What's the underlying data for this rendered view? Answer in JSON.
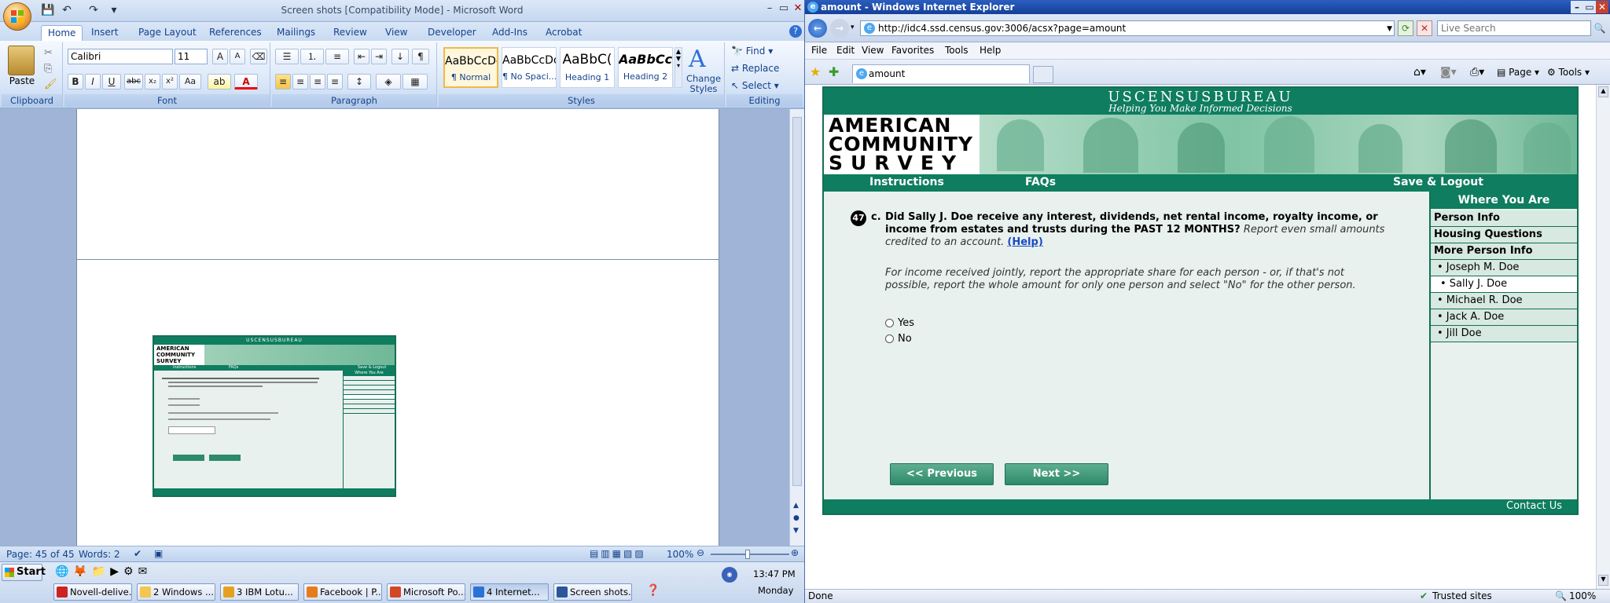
{
  "word": {
    "title": "Screen shots [Compatibility Mode] - Microsoft Word",
    "tabs": [
      "Home",
      "Insert",
      "Page Layout",
      "References",
      "Mailings",
      "Review",
      "View",
      "Developer",
      "Add-Ins",
      "Acrobat"
    ],
    "clipboard": {
      "paste": "Paste",
      "label": "Clipboard"
    },
    "font": {
      "name": "Calibri",
      "size": "11",
      "label": "Font"
    },
    "paragraph": {
      "label": "Paragraph"
    },
    "styles": {
      "label": "Styles",
      "items": [
        {
          "sample": "AaBbCcDc",
          "name": "¶ Normal"
        },
        {
          "sample": "AaBbCcDc",
          "name": "¶ No Spaci..."
        },
        {
          "sample": "AaBbC(",
          "name": "Heading 1"
        },
        {
          "sample": "AaBbCc",
          "name": "Heading 2"
        }
      ],
      "change": "Change Styles"
    },
    "editing": {
      "find": "Find",
      "replace": "Replace",
      "select": "Select",
      "label": "Editing"
    },
    "status": {
      "page": "Page: 45 of 45",
      "words": "Words: 2",
      "zoom": "100%"
    },
    "thumb": {
      "brand": "USCENSUSBUREAU",
      "lines": [
        "AMERICAN",
        "COMMUNITY",
        "SURVEY"
      ],
      "nav": [
        "Instructions",
        "FAQs",
        "Save & Logout"
      ],
      "side_title": "Where You Are"
    }
  },
  "taskbar": {
    "start": "Start",
    "time": "13:47 PM",
    "day": "Monday",
    "buttons": [
      "Novell-delive...",
      "2 Windows ...",
      "3 IBM Lotu...",
      "Facebook | P...",
      "Microsoft Po...",
      "4 Internet...",
      "Screen shots..."
    ]
  },
  "ie": {
    "title": "amount - Windows Internet Explorer",
    "url": "http://idc4.ssd.census.gov:3006/acsx?page=amount",
    "search_placeholder": "Live Search",
    "menu": [
      "File",
      "Edit",
      "View",
      "Favorites",
      "Tools",
      "Help"
    ],
    "tab": "amount",
    "toolbar": {
      "page": "Page",
      "tools": "Tools"
    },
    "status": {
      "left": "Done",
      "zone": "Trusted sites",
      "zoom": "100%"
    }
  },
  "acs": {
    "brand": "USCENSUSBUREAU",
    "tagline": "Helping You Make Informed Decisions",
    "logo": [
      "AMERICAN",
      "COMMUNITY",
      "SURVEY"
    ],
    "nav": {
      "instructions": "Instructions",
      "faqs": "FAQs",
      "logout": "Save & Logout"
    },
    "question": {
      "number": "47",
      "letter": "c.",
      "text": "Did Sally J. Doe receive any interest, dividends, net rental income, royalty income, or income from estates and trusts during the PAST 12 MONTHS?",
      "hint": "Report even small amounts credited to an account.",
      "help": "(Help)",
      "note": "For income received jointly, report the appropriate share for each person - or, if that's not possible, report the whole amount for only one person and select \"No\" for the other person.",
      "options": [
        "Yes",
        "No"
      ]
    },
    "buttons": {
      "previous": "<<   Previous",
      "next": "Next   >>"
    },
    "side": {
      "title": "Where You Are",
      "items": [
        {
          "label": "Person Info",
          "bold": true
        },
        {
          "label": "Housing Questions",
          "bold": true
        },
        {
          "label": "More Person Info",
          "bold": true
        },
        {
          "label": "• Joseph M. Doe"
        },
        {
          "label": "• Sally J. Doe",
          "selected": true
        },
        {
          "label": "• Michael R. Doe"
        },
        {
          "label": "• Jack A. Doe"
        },
        {
          "label": "• Jill Doe"
        }
      ]
    },
    "footer": "Contact Us"
  }
}
